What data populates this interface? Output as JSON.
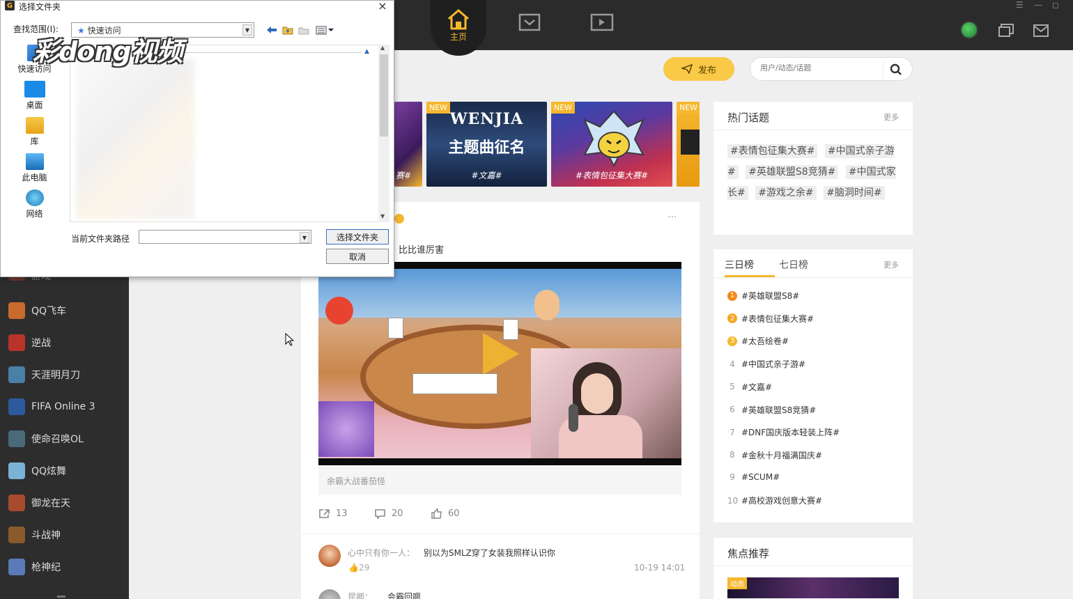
{
  "topnav": {
    "home_label": "主页",
    "icons": [
      "home-icon",
      "inbox-icon",
      "video-icon"
    ]
  },
  "sidebar": {
    "items": [
      {
        "label": "QQ飞车",
        "color": "#c96a2e"
      },
      {
        "label": "逆战",
        "color": "#b8342b"
      },
      {
        "label": "天涯明月刀",
        "color": "#4a7fa8"
      },
      {
        "label": "FIFA Online 3",
        "color": "#2d5a9e"
      },
      {
        "label": "使命召唤OL",
        "color": "#4a6a7a"
      },
      {
        "label": "QQ炫舞",
        "color": "#7ab3d6"
      },
      {
        "label": "御龙在天",
        "color": "#a84a2e"
      },
      {
        "label": "斗战神",
        "color": "#8a5a2a"
      },
      {
        "label": "枪神纪",
        "color": "#5a7ab8"
      }
    ],
    "partial_label": "游戏"
  },
  "actions": {
    "publish_label": "发布",
    "search_placeholder": "用户/动态/话题"
  },
  "banners": [
    {
      "tag": "",
      "title": "",
      "caption": "赛#"
    },
    {
      "tag": "NEW",
      "title": "WENJIA",
      "subtitle": "主题曲征名",
      "caption": "#文嘉#"
    },
    {
      "tag": "NEW",
      "title": "",
      "caption": "#表情包征集大赛#"
    },
    {
      "tag": "NEW",
      "title": "",
      "caption": ""
    }
  ],
  "post": {
    "text": "比比谁厉害",
    "more": "···",
    "video_caption": "余霸大战番茄怪",
    "shares": "13",
    "comments": "20",
    "likes": "60"
  },
  "comments": [
    {
      "user": "心中只有你一人",
      "text": "别以为SMLZ穿了女装我照样认识你",
      "likes": "29",
      "time": "10-19 14:01"
    },
    {
      "user": "昆卿",
      "text": "会霸回嗯"
    }
  ],
  "hot_topics": {
    "title": "热门话题",
    "more": "更多",
    "topics": [
      "#表情包征集大赛#",
      "#中国式亲子游#",
      "#英雄联盟S8竞猜#",
      "#中国式家长#",
      "#游戏之余#",
      "#脑洞时间#"
    ]
  },
  "ranking": {
    "tabs": [
      "三日榜",
      "七日榜"
    ],
    "more": "更多",
    "items": [
      {
        "rank": "1",
        "label": "#英雄联盟S8#"
      },
      {
        "rank": "2",
        "label": "#表情包征集大赛#"
      },
      {
        "rank": "3",
        "label": "#太吾绘卷#"
      },
      {
        "rank": "4",
        "label": "#中国式亲子游#"
      },
      {
        "rank": "5",
        "label": "#文嘉#"
      },
      {
        "rank": "6",
        "label": "#英雄联盟S8竞猜#"
      },
      {
        "rank": "7",
        "label": "#DNF国庆版本轻装上阵#"
      },
      {
        "rank": "8",
        "label": "#金秋十月福满国庆#"
      },
      {
        "rank": "9",
        "label": "#SCUM#"
      },
      {
        "rank": "10",
        "label": "#高校游戏创意大赛#"
      }
    ]
  },
  "focus": {
    "title": "焦点推荐",
    "tag": "动态"
  },
  "dialog": {
    "title": "选择文件夹",
    "look_in_label": "查找范围(I):",
    "look_in_value": "快速访问",
    "places": [
      "快速访问",
      "桌面",
      "库",
      "此电脑",
      "网络"
    ],
    "path_label": "当前文件夹路径",
    "path_value": "",
    "select_button": "选择文件夹",
    "cancel_button": "取消",
    "close": "×"
  },
  "watermark": "彩dong视频",
  "colors": {
    "accent": "#f5b82e",
    "topbar": "#2b2b2b",
    "sidebar": "#2d2d2d"
  }
}
